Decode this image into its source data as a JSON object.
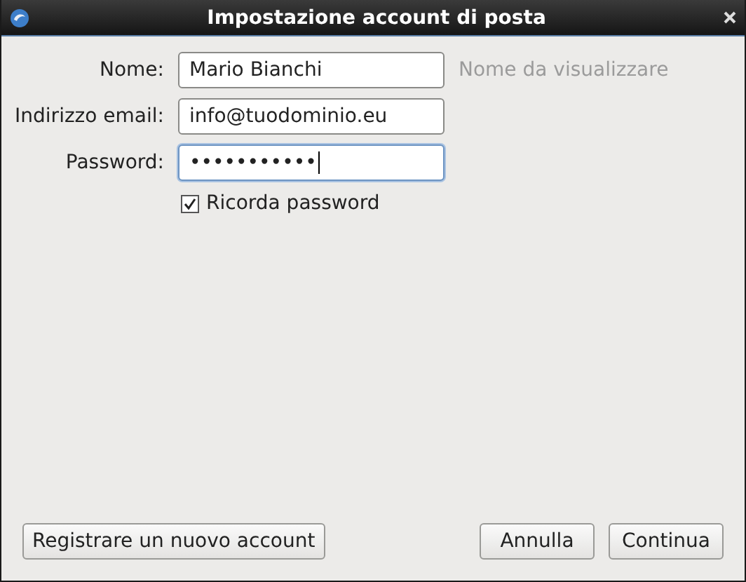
{
  "window": {
    "title": "Impostazione account di posta"
  },
  "fields": [
    {
      "label": "Nome:",
      "value": "Mario Bianchi",
      "hint": "Nome da visualizzare",
      "focused": false
    },
    {
      "label": "Indirizzo email:",
      "value": "info@tuodominio.eu",
      "focused": false
    },
    {
      "label": "Password:",
      "value": "•••••••••••",
      "focused": true
    }
  ],
  "remember_password": {
    "label": "Ricorda password",
    "checked": true
  },
  "buttons": [
    {
      "label": "Registrare un nuovo account"
    },
    {
      "label": "Annulla"
    },
    {
      "label": "Continua"
    }
  ]
}
